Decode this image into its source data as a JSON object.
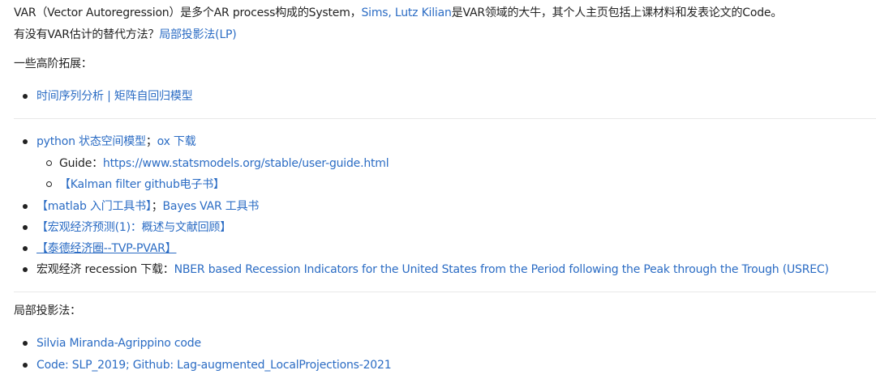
{
  "intro": {
    "p1_a": "VAR（Vector Autoregression）是多个AR process构成的System，",
    "p1_link": "Sims, Lutz Kilian",
    "p1_b": "是VAR领域的大牛，其个人主页包括上课材料和发表论文的Code。",
    "p2_a": "有没有VAR估计的替代方法？",
    "p2_link": "局部投影法(LP)"
  },
  "section1": {
    "heading": "一些高阶拓展：",
    "items": [
      {
        "link_a": "时间序列分析",
        "sep": " | ",
        "link_b": "矩阵自回归模型"
      }
    ]
  },
  "section2": {
    "items": [
      {
        "link_a": "python 状态空间模型",
        "sep": "；",
        "link_b": "ox 下载"
      },
      {
        "label": "Guide：",
        "link": "https://www.statsmodels.org/stable/user-guide.html"
      },
      {
        "link": "【Kalman filter github电子书】"
      },
      {
        "link_a": "【matlab 入门工具书】",
        "sep": "；",
        "link_b": "Bayes VAR 工具书"
      },
      {
        "link": "【宏观经济预测(1)：概述与文献回顾】"
      },
      {
        "link": "【泰德经济圈--TVP-PVAR】"
      },
      {
        "label": "宏观经济 recession 下载：",
        "link": "NBER based Recession Indicators for the United States from the Period following the Peak through the Trough (USREC)"
      }
    ]
  },
  "section3": {
    "heading": "局部投影法：",
    "items": [
      {
        "link": "Silvia Miranda-Agrippino code"
      },
      {
        "link": "Code: SLP_2019; Github: Lag-augmented_LocalProjections-2021"
      }
    ]
  }
}
